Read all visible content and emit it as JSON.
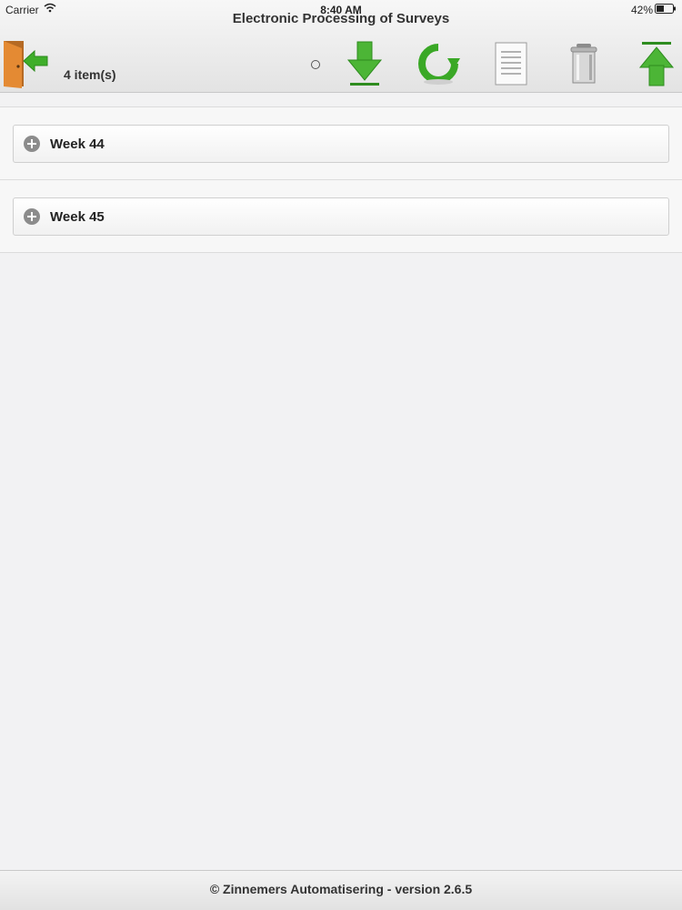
{
  "status_bar": {
    "carrier": "Carrier",
    "time": "8:40 AM",
    "battery": "42%"
  },
  "header": {
    "title": "Electronic Processing of Surveys",
    "item_count": "4 item(s)"
  },
  "toolbar": {
    "icons": [
      "exit-door-icon",
      "download-icon",
      "refresh-icon",
      "document-icon",
      "trash-icon",
      "upload-icon"
    ]
  },
  "groups": [
    {
      "label": "Week 44"
    },
    {
      "label": "Week 45"
    }
  ],
  "footer": {
    "text": "© Zinnemers Automatisering - version 2.6.5"
  },
  "colors": {
    "accent_green": "#3fae2a",
    "door_orange": "#d9822b"
  }
}
